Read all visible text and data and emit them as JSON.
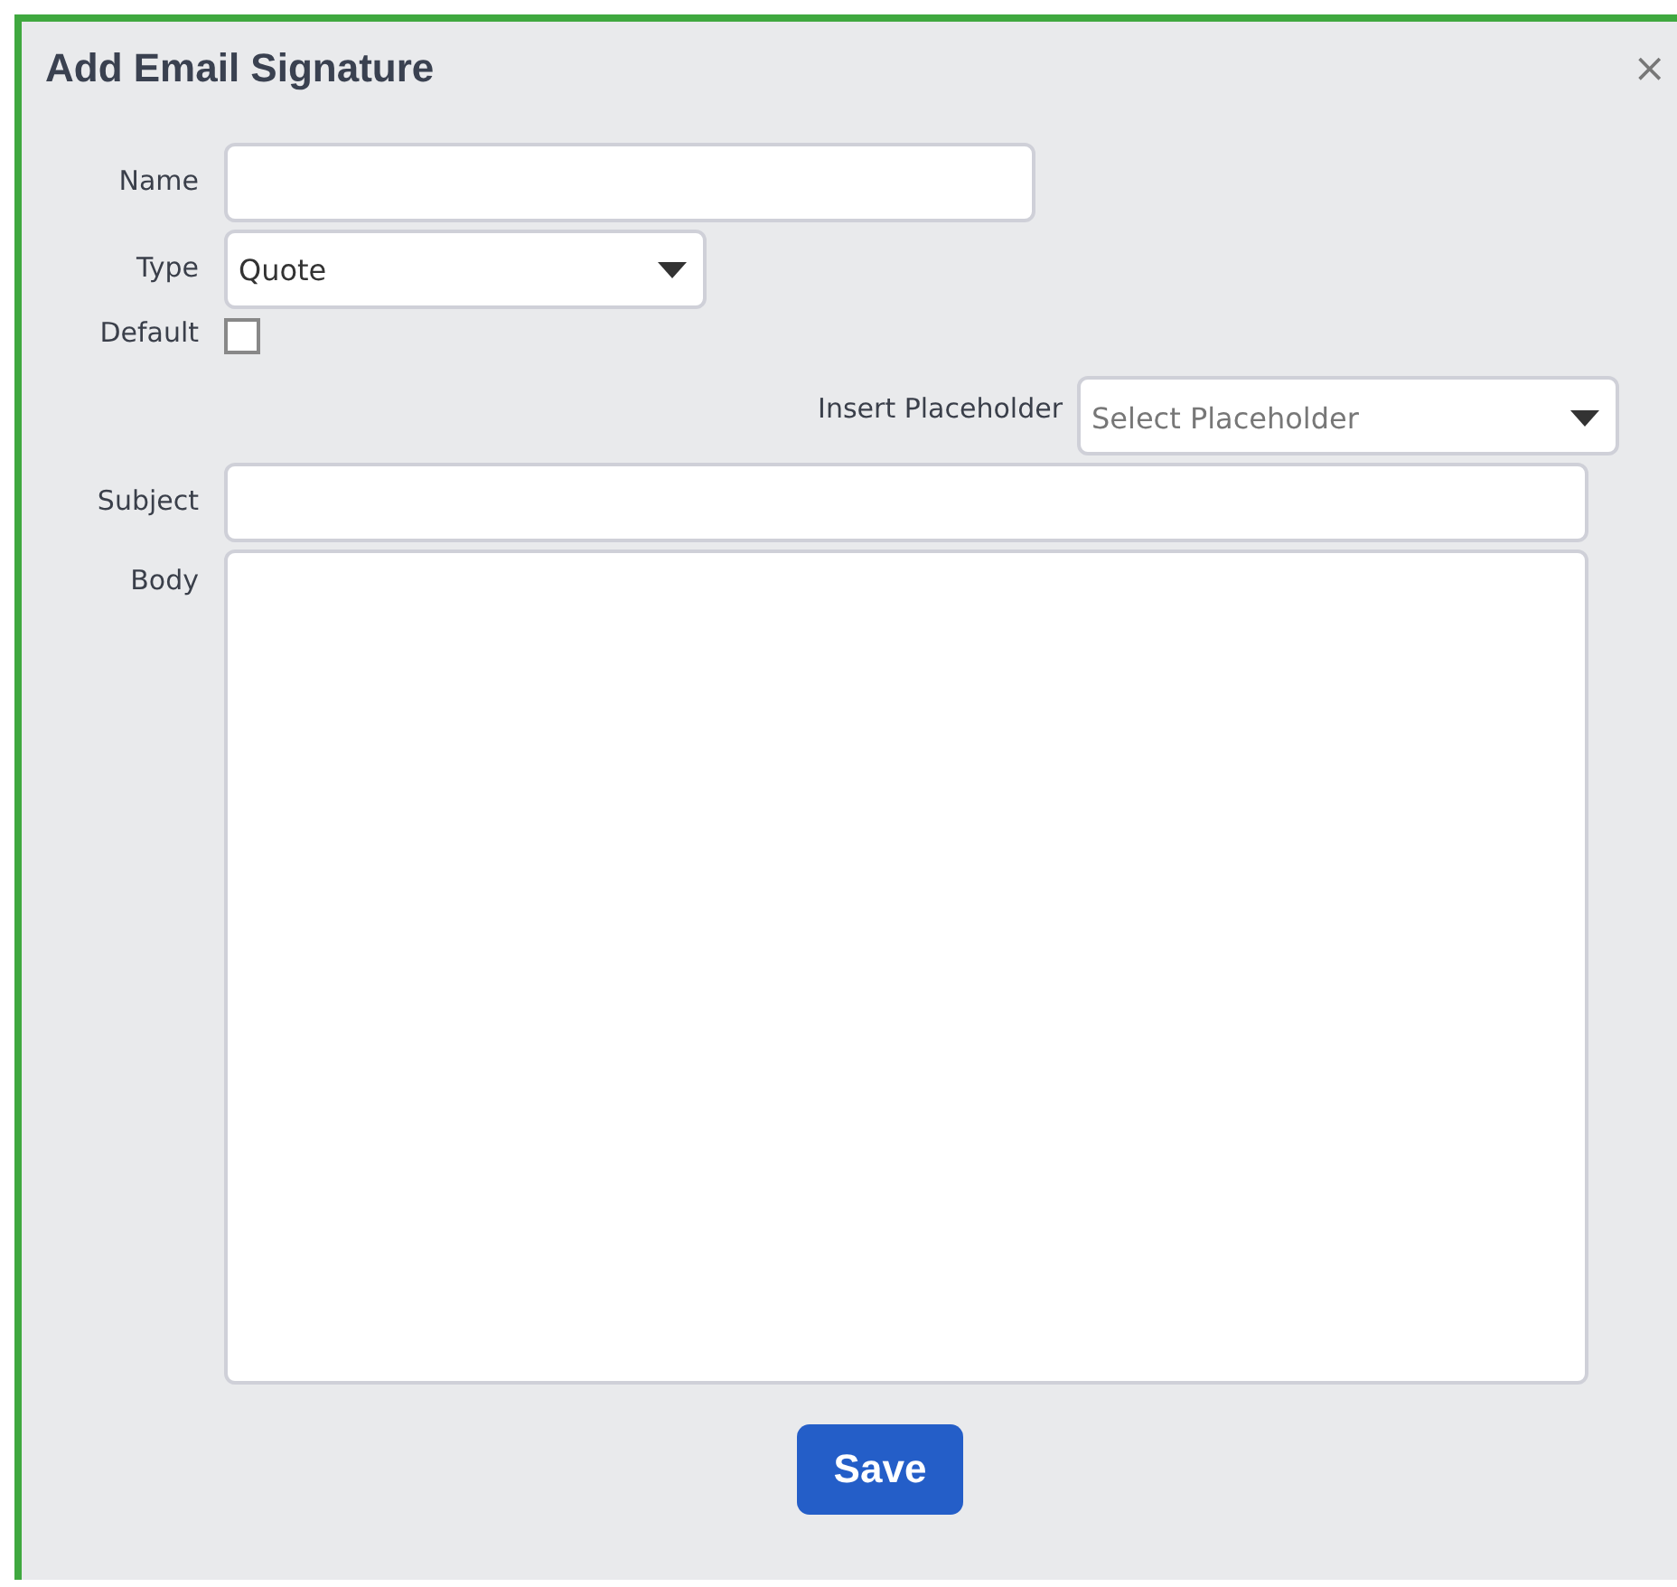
{
  "dialog": {
    "title": "Add Email Signature",
    "close": "×"
  },
  "name_field": {
    "label": "Name"
  },
  "type_field": {
    "label": "Type",
    "value": "Quote"
  },
  "default_field": {
    "label": "Default",
    "checked": false
  },
  "insert_placeholder": {
    "label": "Insert Placeholder",
    "placeholder": "Select Placeholder"
  },
  "subject_field": {
    "label": "Subject"
  },
  "body_field": {
    "label": "Body"
  },
  "save_button": {
    "label": "Save"
  }
}
